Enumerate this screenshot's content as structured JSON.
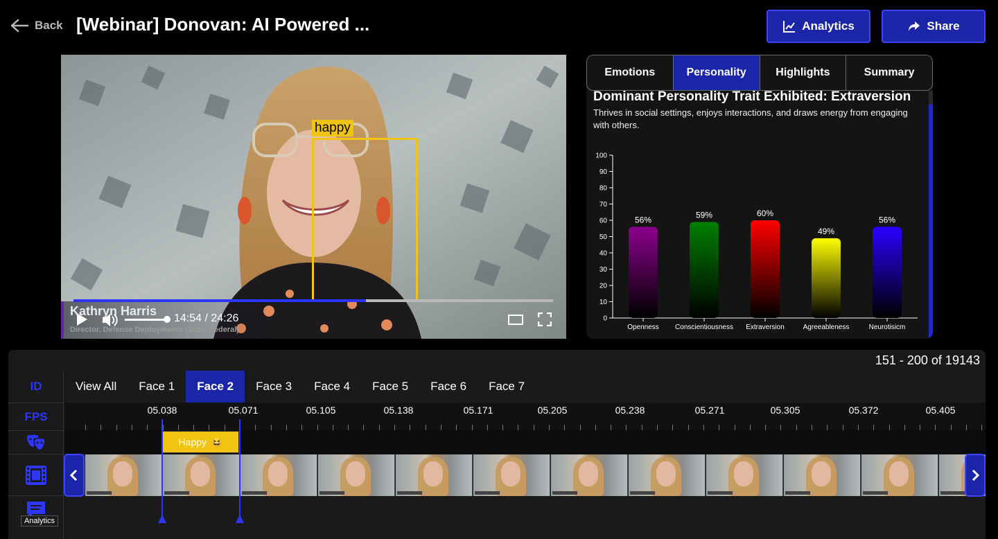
{
  "header": {
    "back_label": "Back",
    "title": "[Webinar] Donovan: AI Powered ...",
    "analytics_label": "Analytics",
    "share_label": "Share"
  },
  "video": {
    "face_label": "happy",
    "current_time": "14:54",
    "duration": "24:26",
    "time_display": "14:54 / 24:26",
    "progress": 0.61,
    "volume": 1.0,
    "speaker_name": "Kathryn Harris",
    "speaker_title": "Director, Defense Deployments (Scale Federal)"
  },
  "panel": {
    "tabs": [
      {
        "label": "Emotions",
        "active": false
      },
      {
        "label": "Personality",
        "active": true
      },
      {
        "label": "Highlights",
        "active": false
      },
      {
        "label": "Summary",
        "active": false
      }
    ],
    "trait_title": "Dominant Personality Trait Exhibited: Extraversion",
    "trait_description": "Thrives in social settings, enjoys interactions, and draws energy from engaging with others."
  },
  "chart_data": {
    "type": "bar",
    "categories": [
      "Openness",
      "Conscientiousness",
      "Extraversion",
      "Agreeableness",
      "Neurotisicm"
    ],
    "values": [
      56,
      59,
      60,
      49,
      56
    ],
    "labels": [
      "56%",
      "59%",
      "60%",
      "49%",
      "56%"
    ],
    "colors": [
      "#8b008b",
      "#008000",
      "#ff0000",
      "#ffff00",
      "#2a00ff"
    ],
    "ylim": [
      0,
      100
    ],
    "yticks": [
      0,
      10,
      20,
      30,
      40,
      50,
      60,
      70,
      80,
      90,
      100
    ],
    "grid": false
  },
  "timeline": {
    "range_text": "151 - 200 of 19143",
    "sidebar": {
      "id_label": "ID",
      "fps_label": "FPS",
      "tooltip": "Analytics"
    },
    "face_tabs": [
      {
        "label": "View All",
        "active": false
      },
      {
        "label": "Face 1",
        "active": false
      },
      {
        "label": "Face 2",
        "active": true
      },
      {
        "label": "Face 3",
        "active": false
      },
      {
        "label": "Face 4",
        "active": false
      },
      {
        "label": "Face 5",
        "active": false
      },
      {
        "label": "Face 6",
        "active": false
      },
      {
        "label": "Face 7",
        "active": false
      }
    ],
    "ruler_labels": [
      "05.038",
      "05.071",
      "05.105",
      "05.138",
      "05.171",
      "05.205",
      "05.238",
      "05.271",
      "05.305",
      "05.372",
      "05.405"
    ],
    "emotion_chip": {
      "label": "Happy",
      "emoji": "😆"
    }
  },
  "colors": {
    "accent": "#1a25a8",
    "accent_border": "#3d44ff",
    "face_box": "#f1c40f"
  }
}
